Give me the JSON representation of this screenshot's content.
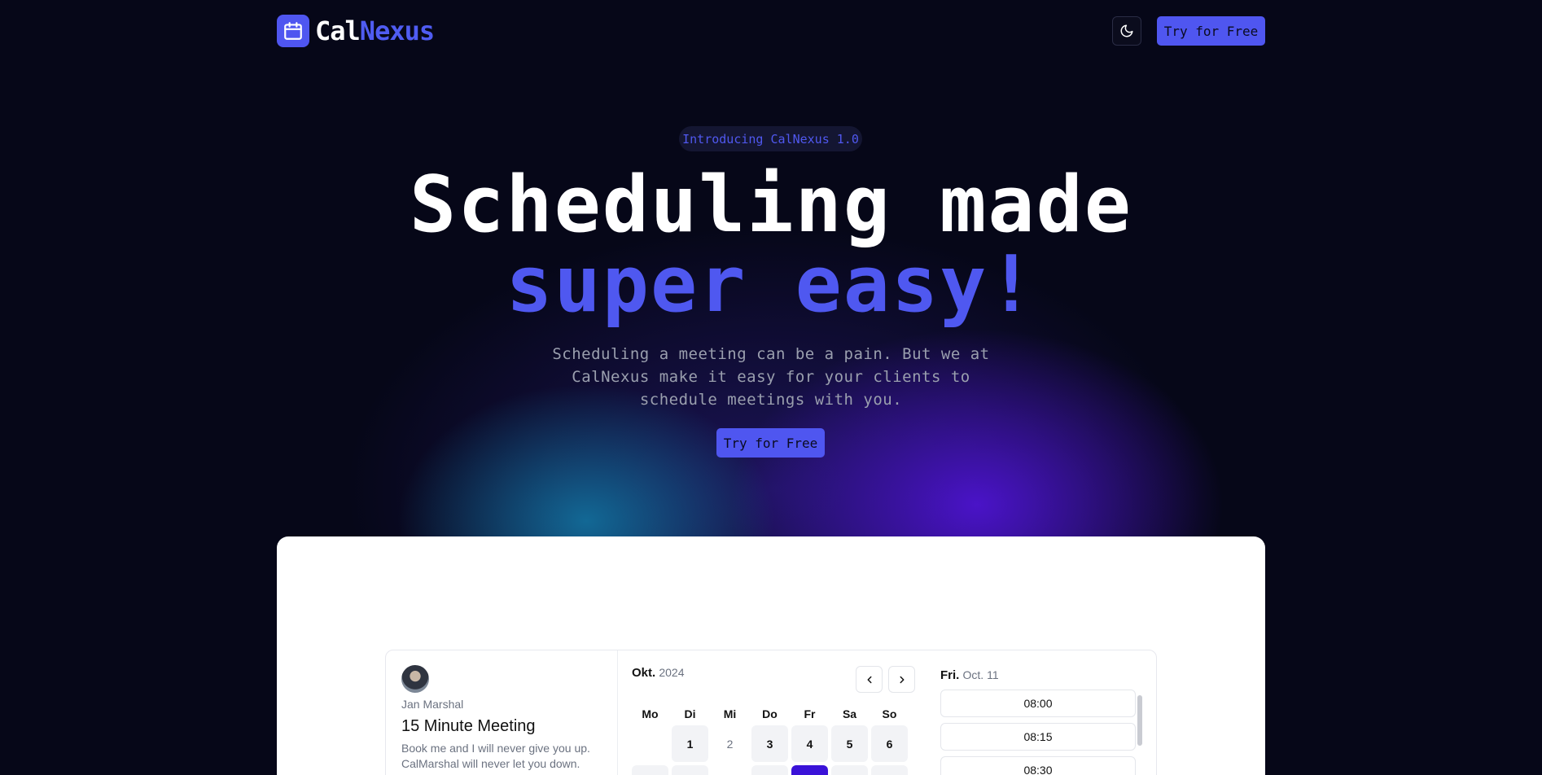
{
  "brand": {
    "name_part1": "Cal",
    "name_part2": "Nexus",
    "accent": "#4f56f0",
    "icon": "calendar-icon"
  },
  "nav": {
    "theme_toggle_icon": "moon-icon",
    "cta_label": "Try for Free"
  },
  "hero": {
    "badge": "Introducing CalNexus 1.0",
    "headline_line1": "Scheduling made",
    "headline_line2": "super easy!",
    "subtext": "Scheduling a meeting can be a pain. But we at CalNexus make it easy for your clients to schedule meetings with you.",
    "cta_label": "Try for Free"
  },
  "booking": {
    "host_name": "Jan Marshal",
    "meeting_title": "15 Minute Meeting",
    "description": "Book me and I will never give you up. CalMarshal will never let you down.",
    "calendar": {
      "month": "Okt.",
      "year": "2024",
      "weekdays": [
        "Mo",
        "Di",
        "Mi",
        "Do",
        "Fr",
        "Sa",
        "So"
      ],
      "days": [
        "1",
        "2",
        "3",
        "4",
        "5",
        "6"
      ],
      "selected_color": "#3a12d8"
    },
    "times": {
      "day": "Fri.",
      "date": "Oct. 11",
      "slots": [
        "08:00",
        "08:15",
        "08:30"
      ]
    }
  }
}
